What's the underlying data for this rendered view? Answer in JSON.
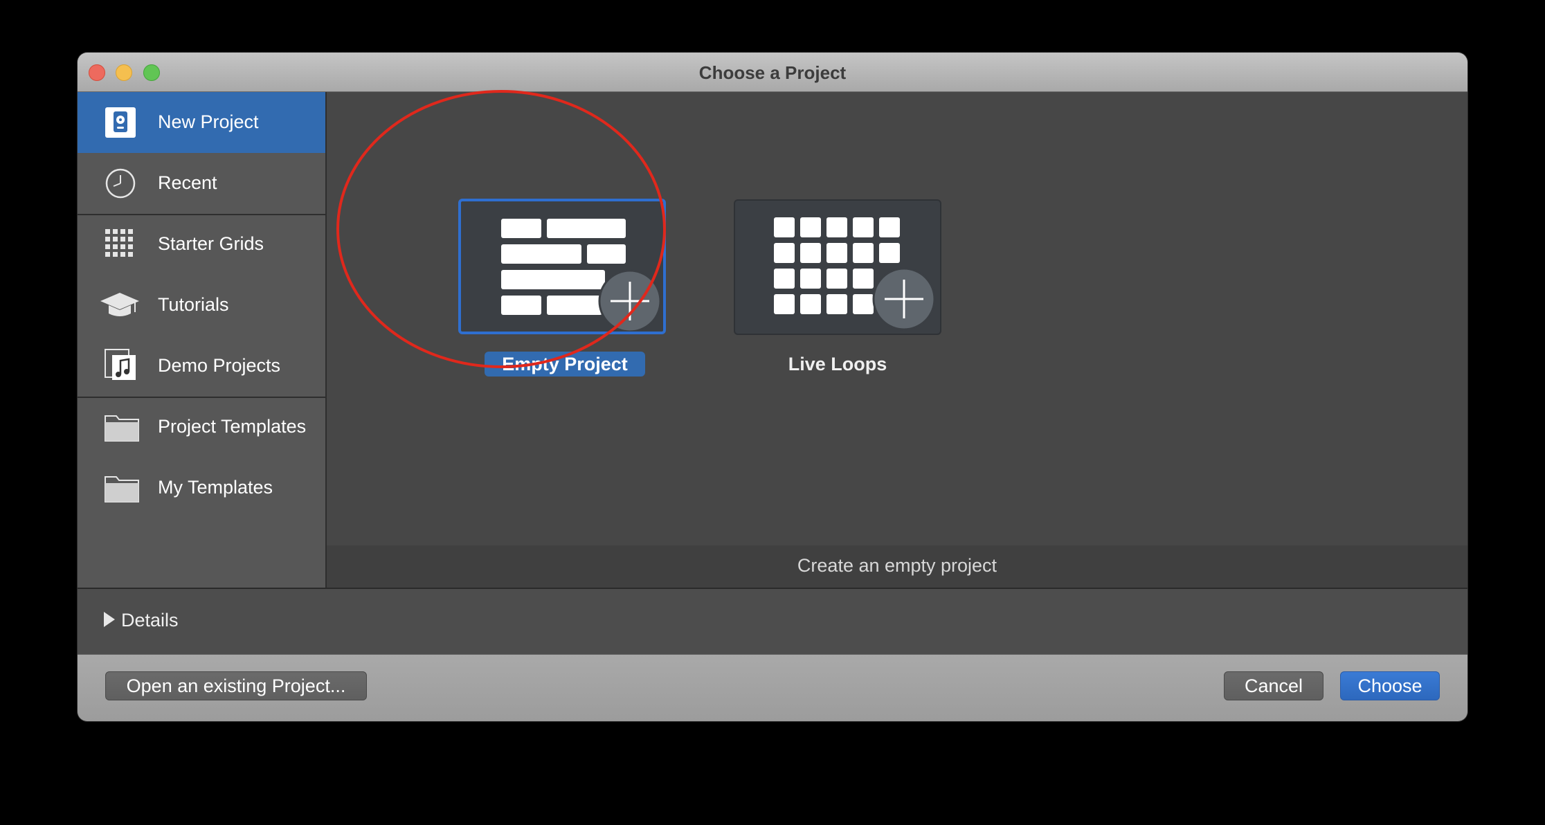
{
  "window": {
    "title": "Choose a Project"
  },
  "sidebar": {
    "items": [
      {
        "label": "New Project",
        "icon": "new-project-icon",
        "selected": true
      },
      {
        "label": "Recent",
        "icon": "clock-icon"
      },
      {
        "label": "Starter Grids",
        "icon": "grid-icon"
      },
      {
        "label": "Tutorials",
        "icon": "graduation-cap-icon"
      },
      {
        "label": "Demo Projects",
        "icon": "music-document-icon"
      },
      {
        "label": "Project Templates",
        "icon": "folder-icon"
      },
      {
        "label": "My Templates",
        "icon": "folder-icon"
      }
    ]
  },
  "content": {
    "tiles": [
      {
        "label": "Empty Project",
        "icon": "empty-project-icon",
        "selected": true
      },
      {
        "label": "Live Loops",
        "icon": "live-loops-icon"
      }
    ],
    "description": "Create an empty project"
  },
  "details": {
    "label": "Details"
  },
  "footer": {
    "open_label": "Open an existing Project...",
    "cancel_label": "Cancel",
    "choose_label": "Choose"
  },
  "colors": {
    "accent": "#326bb0",
    "annotation": "#e0281c"
  }
}
